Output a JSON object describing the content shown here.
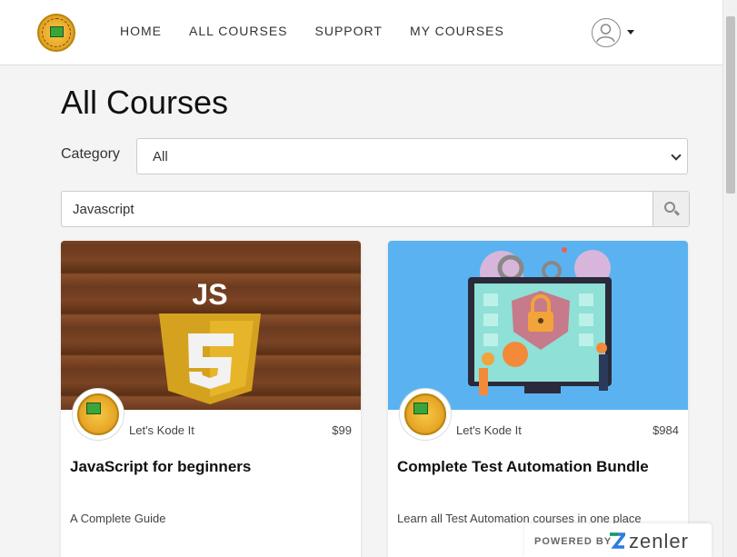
{
  "nav": {
    "items": [
      "HOME",
      "ALL COURSES",
      "SUPPORT",
      "MY COURSES"
    ]
  },
  "page": {
    "title": "All Courses"
  },
  "filter": {
    "category_label": "Category",
    "category_value": "All"
  },
  "search": {
    "value": "Javascript"
  },
  "courses": [
    {
      "author": "Let's Kode It",
      "price": "$99",
      "title": "JavaScript for beginners",
      "subtitle": "A Complete Guide"
    },
    {
      "author": "Let's Kode It",
      "price": "$984",
      "title": "Complete Test Automation Bundle",
      "subtitle": "Learn all Test Automation courses in one place"
    }
  ],
  "footer": {
    "powered_by": "POWERED BY",
    "brand": "zenler"
  }
}
